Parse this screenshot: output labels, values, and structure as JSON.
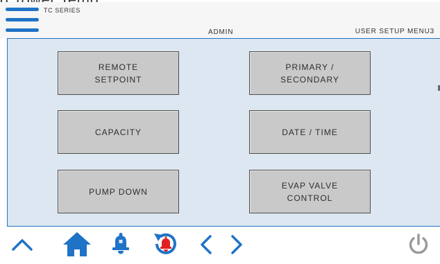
{
  "top_crop": {
    "text": "g Tower Temp"
  },
  "header": {
    "menu_icon": "hamburger-menu-icon",
    "series": "TC SERIES",
    "user": "ADMIN",
    "screen": "USER SETUP MENU3"
  },
  "tiles": [
    {
      "label": "REMOTE\nSETPOINT"
    },
    {
      "label": "PRIMARY /\nSECONDARY"
    },
    {
      "label": "CAPACITY"
    },
    {
      "label": "DATE / TIME"
    },
    {
      "label": "PUMP DOWN"
    },
    {
      "label": "EVAP VALVE\nCONTROL"
    }
  ],
  "footer": {
    "icons": [
      "chevron-up-icon",
      "home-icon",
      "alarm-bell-icon",
      "alarm-history-icon",
      "chevron-left-icon",
      "chevron-right-icon",
      "power-icon"
    ]
  },
  "colors": {
    "accent": "#1f73c6",
    "alarm": "#e02020",
    "tile_bg": "#c9c9c9",
    "panel_bg": "#dde7f1",
    "power_icon": "#9a9a9a"
  }
}
